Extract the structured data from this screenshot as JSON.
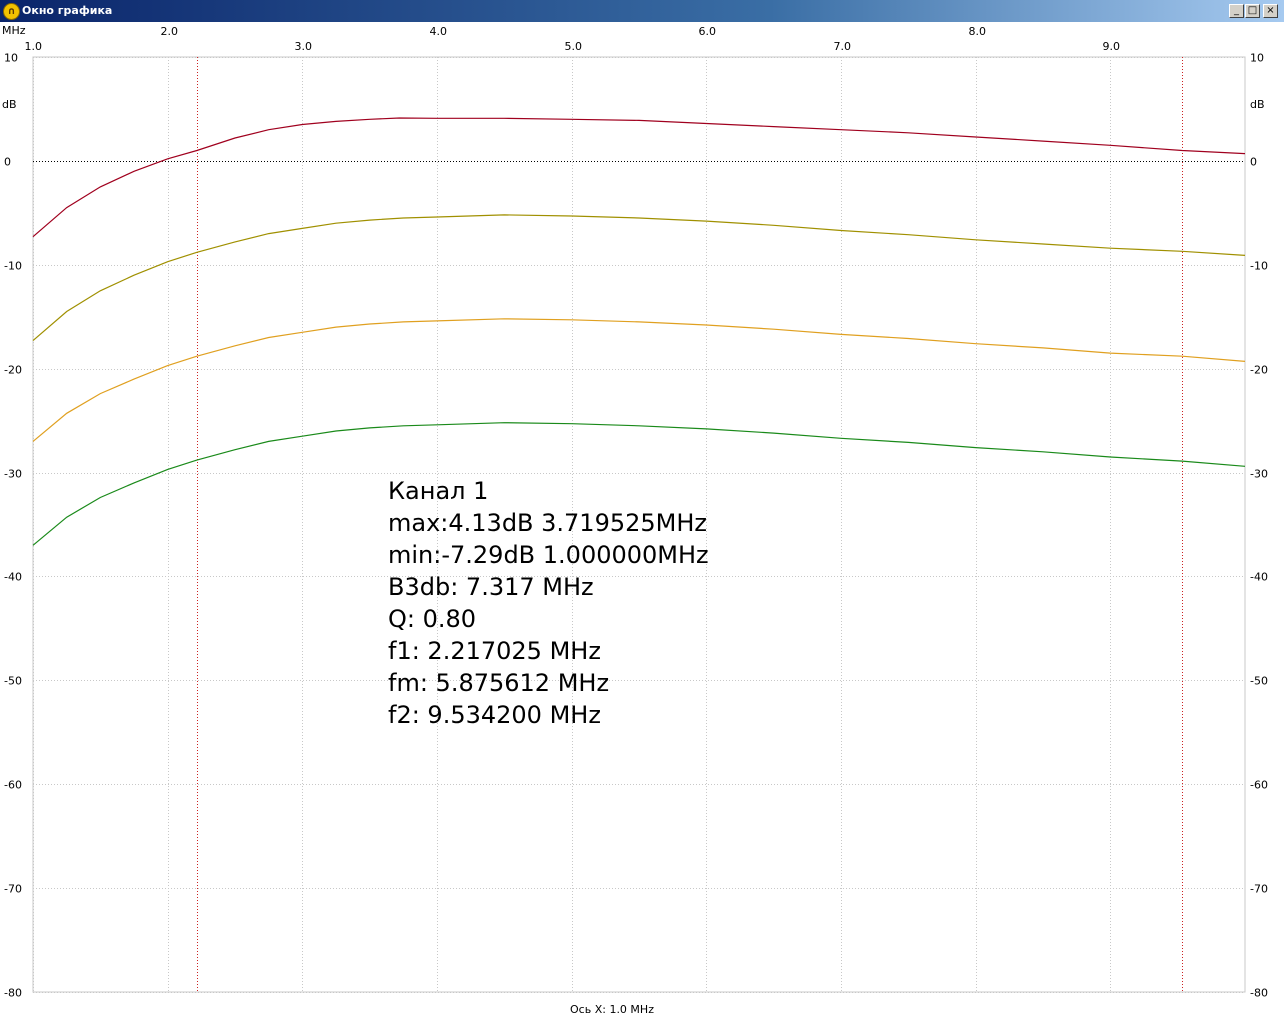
{
  "window": {
    "title": "Окно графика",
    "buttons": {
      "minimize": "_",
      "maximize": "□",
      "close": "×"
    }
  },
  "chart_data": {
    "type": "line",
    "x_unit_label": "MHz",
    "x_ticks": [
      "1.0",
      "2.0",
      "3.0",
      "4.0",
      "5.0",
      "6.0",
      "7.0",
      "8.0",
      "9.0"
    ],
    "xlim": [
      1.0,
      10.0
    ],
    "y_unit_label": "dB",
    "y_ticks": [
      "10",
      "0",
      "-10",
      "-20",
      "-30",
      "-40",
      "-50",
      "-60",
      "-70",
      "-80"
    ],
    "ylim": [
      -80,
      10
    ],
    "xlabel": "Ось X: 1.0 MHz",
    "grid": true,
    "markers": [
      2.217025,
      9.5342
    ],
    "series": [
      {
        "color": "#a0001e",
        "x": [
          1.0,
          1.25,
          1.5,
          1.75,
          2.0,
          2.217,
          2.5,
          2.75,
          3.0,
          3.25,
          3.5,
          3.72,
          4.0,
          4.5,
          5.0,
          5.5,
          6.0,
          6.5,
          7.0,
          7.5,
          8.0,
          8.5,
          9.0,
          9.534,
          10.0
        ],
        "y": [
          -7.3,
          -4.5,
          -2.5,
          -1.0,
          0.2,
          1.0,
          2.2,
          3.0,
          3.5,
          3.8,
          4.0,
          4.13,
          4.1,
          4.1,
          4.0,
          3.9,
          3.6,
          3.3,
          3.0,
          2.7,
          2.3,
          1.9,
          1.5,
          1.0,
          0.7
        ]
      },
      {
        "color": "#a09000",
        "x": [
          1.0,
          1.25,
          1.5,
          1.75,
          2.0,
          2.217,
          2.5,
          2.75,
          3.0,
          3.25,
          3.5,
          3.75,
          4.0,
          4.5,
          5.0,
          5.5,
          6.0,
          6.5,
          7.0,
          7.5,
          8.0,
          8.5,
          9.0,
          9.534,
          10.0
        ],
        "y": [
          -17.3,
          -14.5,
          -12.5,
          -11.0,
          -9.7,
          -8.8,
          -7.8,
          -7.0,
          -6.5,
          -6.0,
          -5.7,
          -5.5,
          -5.4,
          -5.2,
          -5.3,
          -5.5,
          -5.8,
          -6.2,
          -6.7,
          -7.1,
          -7.6,
          -8.0,
          -8.4,
          -8.7,
          -9.1
        ]
      },
      {
        "color": "#e0a020",
        "x": [
          1.0,
          1.25,
          1.5,
          1.75,
          2.0,
          2.217,
          2.5,
          2.75,
          3.0,
          3.25,
          3.5,
          3.75,
          4.0,
          4.5,
          5.0,
          5.5,
          6.0,
          6.5,
          7.0,
          7.5,
          8.0,
          8.5,
          9.0,
          9.534,
          10.0
        ],
        "y": [
          -27.0,
          -24.3,
          -22.4,
          -21.0,
          -19.7,
          -18.8,
          -17.8,
          -17.0,
          -16.5,
          -16.0,
          -15.7,
          -15.5,
          -15.4,
          -15.2,
          -15.3,
          -15.5,
          -15.8,
          -16.2,
          -16.7,
          -17.1,
          -17.6,
          -18.0,
          -18.5,
          -18.8,
          -19.3
        ]
      },
      {
        "color": "#1a8a1a",
        "x": [
          1.0,
          1.25,
          1.5,
          1.75,
          2.0,
          2.217,
          2.5,
          2.75,
          3.0,
          3.25,
          3.5,
          3.75,
          4.0,
          4.5,
          5.0,
          5.5,
          6.0,
          6.5,
          7.0,
          7.5,
          8.0,
          8.5,
          9.0,
          9.534,
          10.0
        ],
        "y": [
          -37.0,
          -34.3,
          -32.4,
          -31.0,
          -29.7,
          -28.8,
          -27.8,
          -27.0,
          -26.5,
          -26.0,
          -25.7,
          -25.5,
          -25.4,
          -25.2,
          -25.3,
          -25.5,
          -25.8,
          -26.2,
          -26.7,
          -27.1,
          -27.6,
          -28.0,
          -28.5,
          -28.9,
          -29.4
        ]
      }
    ],
    "annotation": [
      "Канал 1",
      "max:4.13dB 3.719525MHz",
      "min:-7.29dB 1.000000MHz",
      "B3db: 7.317 MHz",
      "Q: 0.80",
      "f1: 2.217025 MHz",
      "fm: 5.875612 MHz",
      "f2: 9.534200 MHz"
    ]
  }
}
